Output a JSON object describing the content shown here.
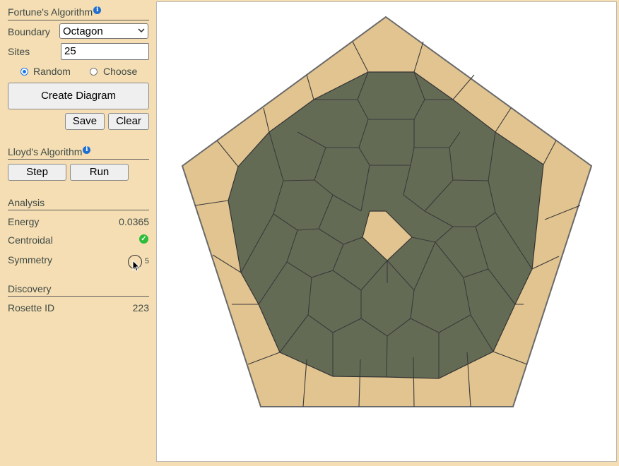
{
  "fortune": {
    "title": "Fortune's Algorithm",
    "info_glyph": "i"
  },
  "boundary": {
    "label": "Boundary",
    "value": "Octagon"
  },
  "sites": {
    "label": "Sites",
    "value": "25"
  },
  "mode": {
    "random_label": "Random",
    "choose_label": "Choose",
    "selected": "random"
  },
  "buttons": {
    "create": "Create Diagram",
    "save": "Save",
    "clear": "Clear",
    "step": "Step",
    "run": "Run"
  },
  "lloyd": {
    "title": "Lloyd's Algorithm",
    "info_glyph": "i"
  },
  "analysis": {
    "title": "Analysis",
    "energy_label": "Energy",
    "energy_value": "0.0365",
    "centroidal_label": "Centroidal",
    "centroidal_icon": "check-circle-icon",
    "symmetry_label": "Symmetry",
    "symmetry_value": "5"
  },
  "discovery": {
    "title": "Discovery",
    "rosette_label": "Rosette ID",
    "rosette_value": "223"
  },
  "colors": {
    "panel_bg": "#f5deb3",
    "outer_cell": "#e2c490",
    "inner_cell": "#646b55",
    "edge": "#3a3a3a",
    "info": "#1f6fd1",
    "check": "#2ebd3a"
  },
  "diagram": {
    "boundary_shape": "pentagon",
    "outer_ring_cells": 25,
    "inner_region": "dark cells",
    "center_cell": "light pentagon"
  }
}
